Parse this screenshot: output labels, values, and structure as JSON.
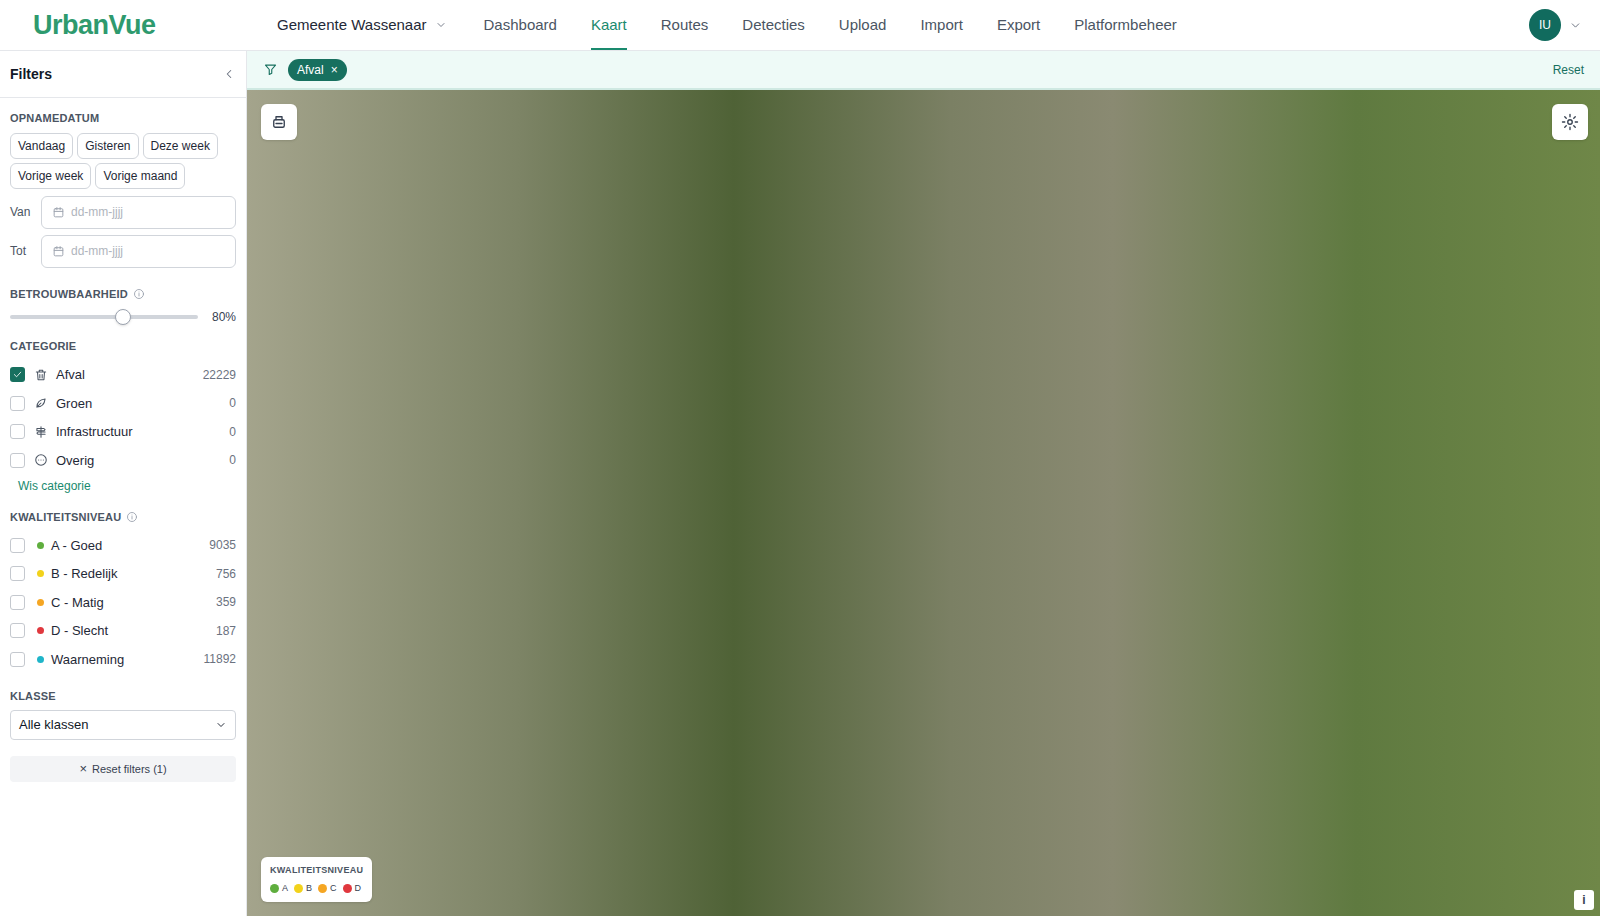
{
  "app": {
    "logo": "UrbanVue"
  },
  "nav": {
    "org": {
      "label": "Gemeente Wassenaar"
    },
    "tabs": [
      {
        "label": "Dashboard",
        "selected": false
      },
      {
        "label": "Kaart",
        "selected": true
      },
      {
        "label": "Routes",
        "selected": false
      },
      {
        "label": "Detecties",
        "selected": false
      },
      {
        "label": "Upload",
        "selected": false
      },
      {
        "label": "Import",
        "selected": false
      },
      {
        "label": "Export",
        "selected": false
      },
      {
        "label": "Platformbeheer",
        "selected": false
      }
    ],
    "user": {
      "initials": "IU"
    }
  },
  "filter_bar": {
    "chips": [
      {
        "label": "Afval",
        "remove": "×"
      }
    ],
    "reset": "Reset"
  },
  "sidebar": {
    "title": "Filters",
    "date": {
      "heading": "OPNAMEDATUM",
      "presets": [
        "Vandaag",
        "Gisteren",
        "Deze week",
        "Vorige week",
        "Vorige maand"
      ],
      "from": {
        "label": "Van",
        "placeholder": "dd-mm-jjjj"
      },
      "to": {
        "label": "Tot",
        "placeholder": "dd-mm-jjjj"
      }
    },
    "reliability": {
      "heading": "BETROUWBAARHEID",
      "level": 0.6,
      "reading": "80%"
    },
    "category": {
      "heading": "CATEGORIE",
      "clear": "Wis categorie",
      "items": [
        {
          "label": "Afval",
          "count": "22229",
          "checked": true,
          "kind": "trash"
        },
        {
          "label": "Groen",
          "count": "0",
          "checked": false,
          "kind": "leaf"
        },
        {
          "label": "Infrastructuur",
          "count": "0",
          "checked": false,
          "kind": "sign"
        },
        {
          "label": "Overig",
          "count": "0",
          "checked": false,
          "kind": "dots"
        }
      ]
    },
    "quality": {
      "heading": "KWALITEITSNIVEAU",
      "items": [
        {
          "label": "A - Goed",
          "count": "9035",
          "checked": false,
          "color": "#5fae3e"
        },
        {
          "label": "B - Redelijk",
          "count": "756",
          "checked": false,
          "color": "#f2d21b"
        },
        {
          "label": "C - Matig",
          "count": "359",
          "checked": false,
          "color": "#f5a623"
        },
        {
          "label": "D - Slecht",
          "count": "187",
          "checked": false,
          "color": "#e0383e"
        },
        {
          "label": "Waarneming",
          "count": "11892",
          "checked": false,
          "color": "#1fb5c9"
        }
      ]
    },
    "class": {
      "heading": "KLASSE",
      "value": "Alle klassen"
    },
    "reset": {
      "icon": "×",
      "label": "Reset filters (1)"
    }
  },
  "map": {
    "legend": {
      "title": "KWALITEITSNIVEAU",
      "items": [
        {
          "label": "A",
          "color": "#5fae3e"
        },
        {
          "label": "B",
          "color": "#f2d21b"
        },
        {
          "label": "C",
          "color": "#f5a623"
        },
        {
          "label": "D",
          "color": "#e0383e"
        }
      ]
    },
    "info": "i"
  }
}
